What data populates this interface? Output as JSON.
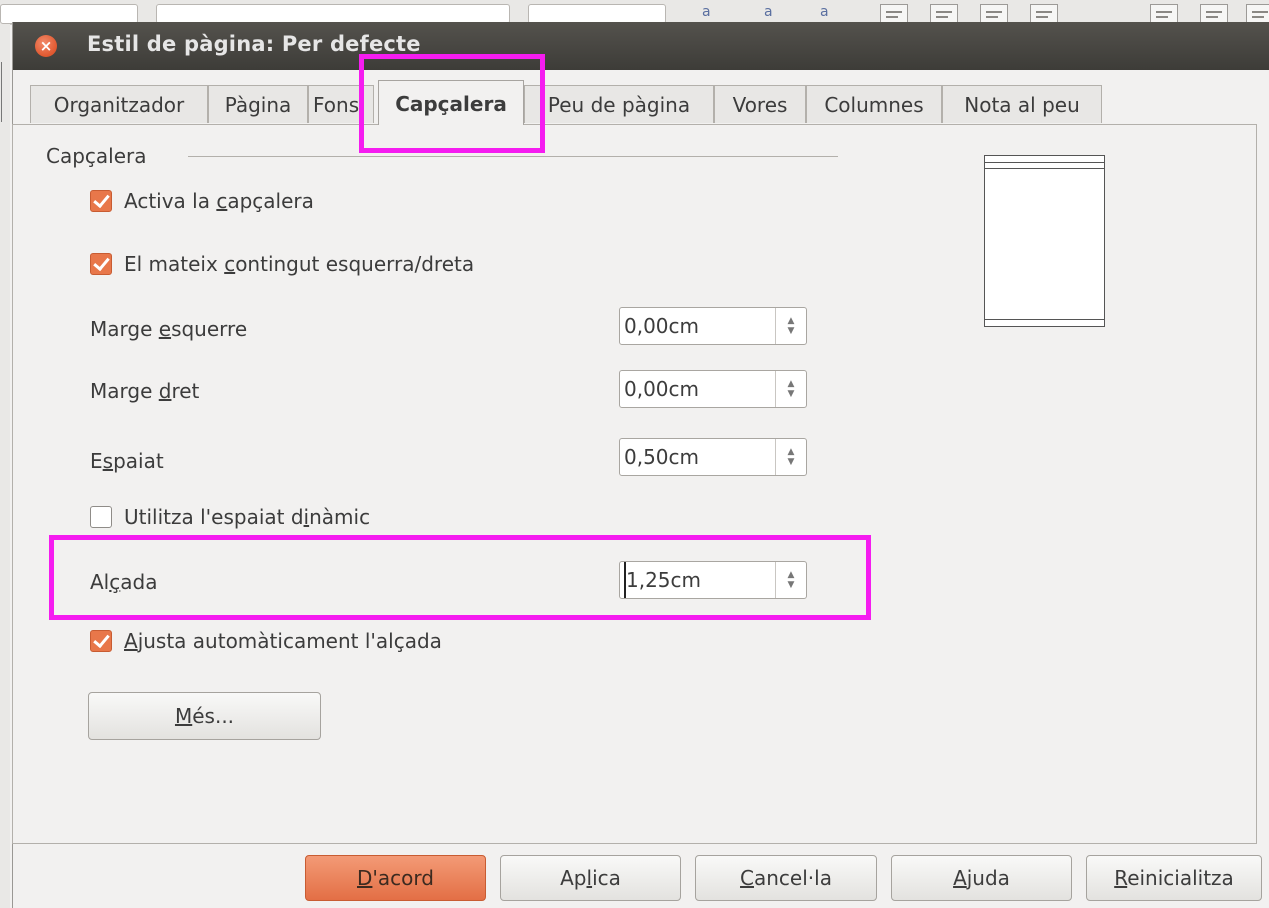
{
  "dialog": {
    "title": "Estil de pàgina: Per defecte"
  },
  "tabs": [
    {
      "label": "Organitzador"
    },
    {
      "label": "Pàgina"
    },
    {
      "label": "Fons"
    },
    {
      "label": "Capçalera",
      "active": true
    },
    {
      "label": "Peu de pàgina"
    },
    {
      "label": "Vores"
    },
    {
      "label": "Columnes"
    },
    {
      "label": "Nota al peu"
    }
  ],
  "header_section": {
    "title": "Capçalera",
    "activate_header": {
      "pre": "Activa la ",
      "mnemonic": "c",
      "post": "apçalera",
      "checked": true
    },
    "same_content": {
      "pre": "El mateix ",
      "mnemonic": "c",
      "post": "ontingut esquerra/dreta",
      "checked": true
    },
    "left_margin": {
      "pre": "Marge ",
      "mnemonic": "e",
      "post": "squerre",
      "value": "0,00cm"
    },
    "right_margin": {
      "pre": "Marge ",
      "mnemonic": "d",
      "post": "ret",
      "value": "0,00cm"
    },
    "spacing": {
      "pre": "E",
      "mnemonic": "s",
      "post": "paiat",
      "value": "0,50cm"
    },
    "dynamic_spacing": {
      "pre": "Utilitza l'espaiat d",
      "mnemonic": "i",
      "post": "nàmic",
      "checked": false
    },
    "height": {
      "pre": "Al",
      "mnemonic": "ç",
      "post": "ada",
      "value": "1,25cm"
    },
    "autofit_height": {
      "pre": "",
      "mnemonic": "A",
      "post": "justa automàticament l'alçada",
      "checked": true
    },
    "more_button": {
      "mnemonic": "M",
      "post": "és..."
    }
  },
  "buttons": {
    "ok": {
      "mnemonic": "D",
      "post": "'acord"
    },
    "apply": {
      "pre": "Ap",
      "mnemonic": "l",
      "post": "ica"
    },
    "cancel": {
      "mnemonic": "C",
      "post": "ancel·la"
    },
    "help": {
      "mnemonic": "A",
      "post": "juda"
    },
    "reset": {
      "mnemonic": "R",
      "post": "einicialitza"
    }
  },
  "colors": {
    "highlight": "#f51cf0",
    "accent": "#e8774a",
    "titlebar": "#3d3c38"
  }
}
